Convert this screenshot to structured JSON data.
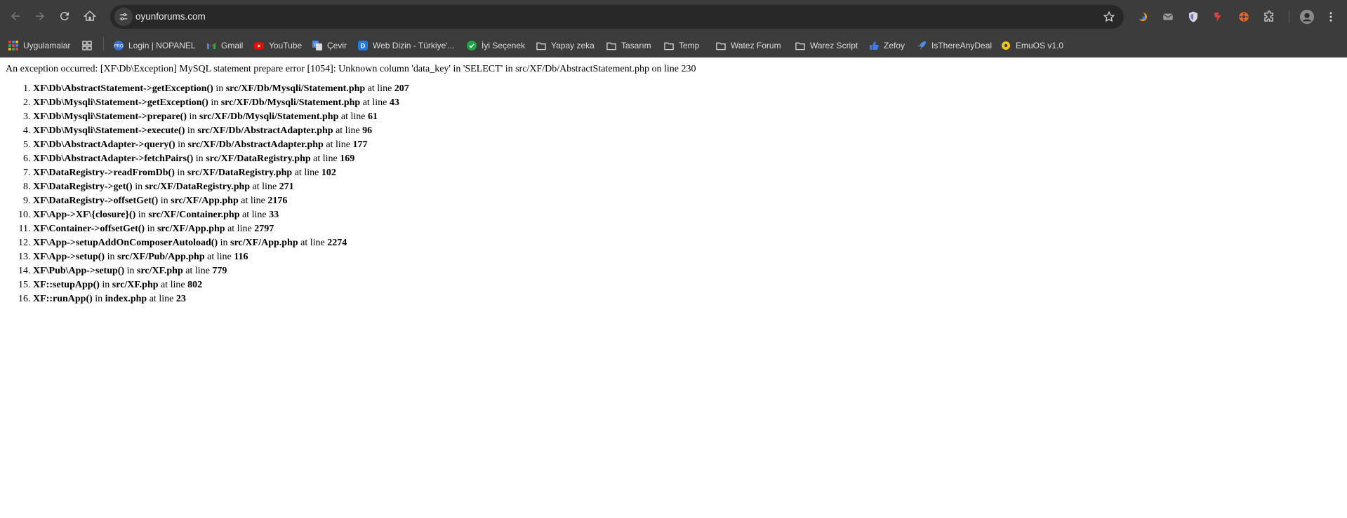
{
  "browser": {
    "url": "oyunforums.com",
    "bookmarks": [
      {
        "label": "Uygulamalar",
        "icon": "apps-grid-icon"
      },
      {
        "label": "",
        "icon": "tab-groups-icon"
      },
      {
        "label": "Login | NOPANEL",
        "icon": "nopanel-icon"
      },
      {
        "label": "Gmail",
        "icon": "gmail-icon"
      },
      {
        "label": "YouTube",
        "icon": "youtube-icon"
      },
      {
        "label": "Çevir",
        "icon": "translate-icon"
      },
      {
        "label": "Web Dizin - Türkiye'...",
        "icon": "web-dizin-icon"
      },
      {
        "label": "İyi Seçenek",
        "icon": "shield-check-icon"
      },
      {
        "label": "Yapay zeka",
        "icon": "folder-icon"
      },
      {
        "label": "Tasarım",
        "icon": "folder-icon"
      },
      {
        "label": "Temp",
        "icon": "folder-icon"
      },
      {
        "label": "Watez Forum",
        "icon": "folder-icon"
      },
      {
        "label": "Warez Script",
        "icon": "folder-icon"
      },
      {
        "label": "Zefoy",
        "icon": "thumbs-up-icon"
      },
      {
        "label": "IsThereAnyDeal",
        "icon": "rocket-icon"
      },
      {
        "label": "EmuOS v1.0",
        "icon": "emuos-icon"
      }
    ],
    "extensions": [
      "moon-ext-icon",
      "mail-ext-icon",
      "shield-ext-icon",
      "red-ext-icon",
      "film-ext-icon",
      "puzzle-icon"
    ]
  },
  "error": {
    "message": "An exception occurred: [XF\\Db\\Exception] MySQL statement prepare error [1054]: Unknown column 'data_key' in 'SELECT' in src/XF/Db/AbstractStatement.php on line 230",
    "trace": [
      {
        "call": "XF\\Db\\AbstractStatement->getException()",
        "file": "src/XF/Db/Mysqli/Statement.php",
        "line": "207"
      },
      {
        "call": "XF\\Db\\Mysqli\\Statement->getException()",
        "file": "src/XF/Db/Mysqli/Statement.php",
        "line": "43"
      },
      {
        "call": "XF\\Db\\Mysqli\\Statement->prepare()",
        "file": "src/XF/Db/Mysqli/Statement.php",
        "line": "61"
      },
      {
        "call": "XF\\Db\\Mysqli\\Statement->execute()",
        "file": "src/XF/Db/AbstractAdapter.php",
        "line": "96"
      },
      {
        "call": "XF\\Db\\AbstractAdapter->query()",
        "file": "src/XF/Db/AbstractAdapter.php",
        "line": "177"
      },
      {
        "call": "XF\\Db\\AbstractAdapter->fetchPairs()",
        "file": "src/XF/DataRegistry.php",
        "line": "169"
      },
      {
        "call": "XF\\DataRegistry->readFromDb()",
        "file": "src/XF/DataRegistry.php",
        "line": "102"
      },
      {
        "call": "XF\\DataRegistry->get()",
        "file": "src/XF/DataRegistry.php",
        "line": "271"
      },
      {
        "call": "XF\\DataRegistry->offsetGet()",
        "file": "src/XF/App.php",
        "line": "2176"
      },
      {
        "call": "XF\\App->XF\\{closure}()",
        "file": "src/XF/Container.php",
        "line": "33"
      },
      {
        "call": "XF\\Container->offsetGet()",
        "file": "src/XF/App.php",
        "line": "2797"
      },
      {
        "call": "XF\\App->setupAddOnComposerAutoload()",
        "file": "src/XF/App.php",
        "line": "2274"
      },
      {
        "call": "XF\\App->setup()",
        "file": "src/XF/Pub/App.php",
        "line": "116"
      },
      {
        "call": "XF\\Pub\\App->setup()",
        "file": "src/XF.php",
        "line": "779"
      },
      {
        "call": "XF::setupApp()",
        "file": "src/XF.php",
        "line": "802"
      },
      {
        "call": "XF::runApp()",
        "file": "index.php",
        "line": "23"
      }
    ],
    "in_word": "in",
    "at_line_word": "at line"
  }
}
